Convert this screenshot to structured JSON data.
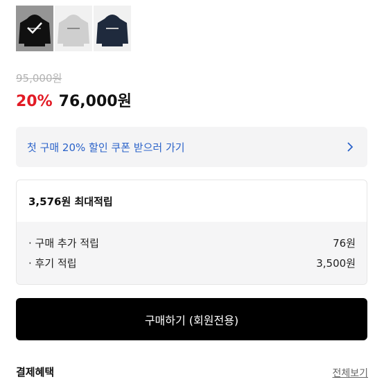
{
  "colors": {
    "discount": "#e21b25",
    "coupon_text": "#2a62c9",
    "buy_button_bg": "#000000"
  },
  "thumbnails": [
    {
      "color_name": "black",
      "hoodie_color": "#1b1b1b",
      "selected": true
    },
    {
      "color_name": "gray",
      "hoodie_color": "#cfcfcf",
      "selected": false
    },
    {
      "color_name": "navy",
      "hoodie_color": "#1f2a3d",
      "selected": false
    }
  ],
  "pricing": {
    "original_price": "95,000원",
    "discount_rate": "20%",
    "sale_price": "76,000원"
  },
  "coupon": {
    "label": "첫 구매 20% 할인 쿠폰 받으러 가기",
    "icon": "chevron-right-icon"
  },
  "points": {
    "title": "3,576원 최대적립",
    "items": [
      {
        "label": "· 구매 추가 적립",
        "value": "76원"
      },
      {
        "label": "· 후기 적립",
        "value": "3,500원"
      }
    ]
  },
  "buy_button": {
    "label": "구매하기 (회원전용)"
  },
  "benefits": {
    "title": "결제혜택",
    "view_all": "전체보기"
  }
}
